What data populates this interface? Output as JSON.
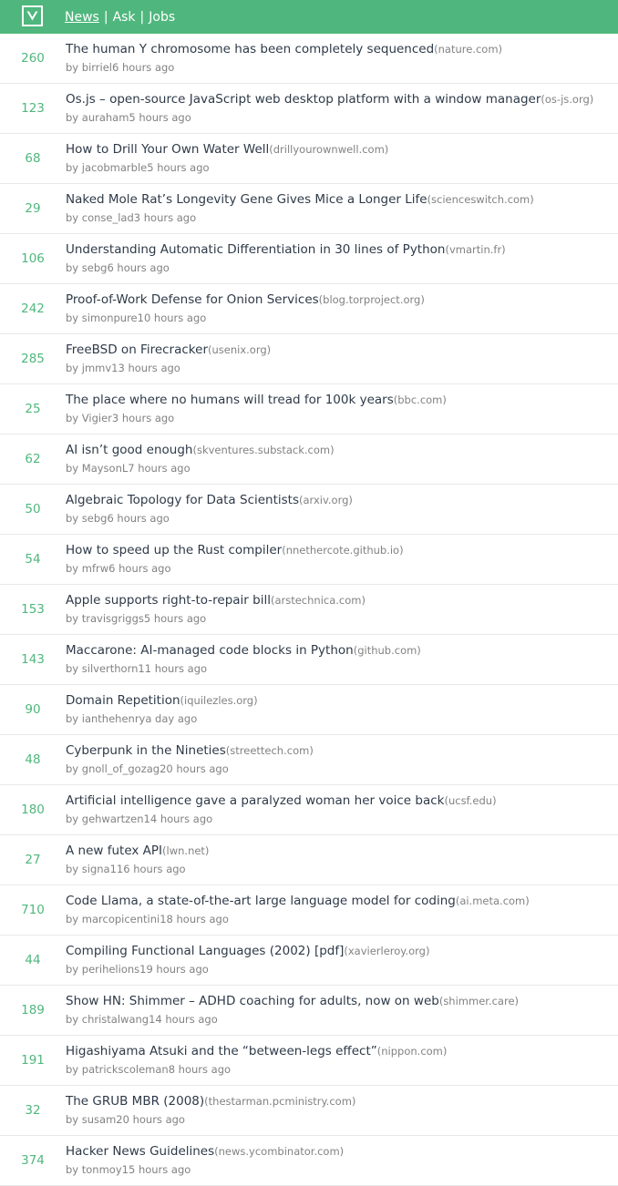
{
  "header": {
    "logo_icon": "vue-logo-icon",
    "nav": [
      {
        "label": "News",
        "active": true
      },
      {
        "label": "Ask",
        "active": false
      },
      {
        "label": "Jobs",
        "active": false
      }
    ],
    "separator": "|",
    "colors": {
      "bar": "#4fb77d",
      "text": "#ffffff"
    }
  },
  "items": [
    {
      "score": "260",
      "title": "The human Y chromosome has been completely sequenced",
      "domain": "(nature.com)",
      "by": "by ",
      "user": "birriel",
      "time": "6 hours ago"
    },
    {
      "score": "123",
      "title": "Os.js – open-source JavaScript web desktop platform with a window manager",
      "domain": "(os-js.org)",
      "by": "by ",
      "user": "auraham",
      "time": "5 hours ago"
    },
    {
      "score": "68",
      "title": "How to Drill Your Own Water Well",
      "domain": "(drillyourownwell.com)",
      "by": "by ",
      "user": "jacobmarble",
      "time": "5 hours ago"
    },
    {
      "score": "29",
      "title": "Naked Mole Rat’s Longevity Gene Gives Mice a Longer Life",
      "domain": "(scienceswitch.com)",
      "by": "by ",
      "user": "conse_lad",
      "time": "3 hours ago"
    },
    {
      "score": "106",
      "title": "Understanding Automatic Differentiation in 30 lines of Python",
      "domain": "(vmartin.fr)",
      "by": "by ",
      "user": "sebg",
      "time": "6 hours ago"
    },
    {
      "score": "242",
      "title": "Proof-of-Work Defense for Onion Services",
      "domain": "(blog.torproject.org)",
      "by": "by ",
      "user": "simonpure",
      "time": "10 hours ago"
    },
    {
      "score": "285",
      "title": "FreeBSD on Firecracker",
      "domain": "(usenix.org)",
      "by": "by ",
      "user": "jmmv",
      "time": "13 hours ago"
    },
    {
      "score": "25",
      "title": "The place where no humans will tread for 100k years",
      "domain": "(bbc.com)",
      "by": "by ",
      "user": "Vigier",
      "time": "3 hours ago"
    },
    {
      "score": "62",
      "title": "AI isn’t good enough",
      "domain": "(skventures.substack.com)",
      "by": "by ",
      "user": "MaysonL",
      "time": "7 hours ago"
    },
    {
      "score": "50",
      "title": "Algebraic Topology for Data Scientists",
      "domain": "(arxiv.org)",
      "by": "by ",
      "user": "sebg",
      "time": "6 hours ago"
    },
    {
      "score": "54",
      "title": "How to speed up the Rust compiler",
      "domain": "(nnethercote.github.io)",
      "by": "by ",
      "user": "mfrw",
      "time": "6 hours ago"
    },
    {
      "score": "153",
      "title": "Apple supports right-to-repair bill",
      "domain": "(arstechnica.com)",
      "by": "by ",
      "user": "travisgriggs",
      "time": "5 hours ago"
    },
    {
      "score": "143",
      "title": "Maccarone: AI-managed code blocks in Python",
      "domain": "(github.com)",
      "by": "by ",
      "user": "silverthorn",
      "time": "11 hours ago"
    },
    {
      "score": "90",
      "title": "Domain Repetition",
      "domain": "(iquilezles.org)",
      "by": "by ",
      "user": "ianthehenry",
      "time": "a day ago"
    },
    {
      "score": "48",
      "title": "Cyberpunk in the Nineties",
      "domain": "(streettech.com)",
      "by": "by ",
      "user": "gnoll_of_gozag",
      "time": "20 hours ago"
    },
    {
      "score": "180",
      "title": "Artificial intelligence gave a paralyzed woman her voice back",
      "domain": "(ucsf.edu)",
      "by": "by ",
      "user": "gehwartzen",
      "time": "14 hours ago"
    },
    {
      "score": "27",
      "title": "A new futex API",
      "domain": "(lwn.net)",
      "by": "by ",
      "user": "signa11",
      "time": "6 hours ago"
    },
    {
      "score": "710",
      "title": "Code Llama, a state-of-the-art large language model for coding",
      "domain": "(ai.meta.com)",
      "by": "by ",
      "user": "marcopicentini",
      "time": "18 hours ago"
    },
    {
      "score": "44",
      "title": "Compiling Functional Languages (2002) [pdf]",
      "domain": "(xavierleroy.org)",
      "by": "by ",
      "user": "perihelions",
      "time": "19 hours ago"
    },
    {
      "score": "189",
      "title": "Show HN: Shimmer – ADHD coaching for adults, now on web",
      "domain": "(shimmer.care)",
      "by": "by ",
      "user": "christalwang",
      "time": "14 hours ago"
    },
    {
      "score": "191",
      "title": "Higashiyama Atsuki and the “between-legs effect”",
      "domain": "(nippon.com)",
      "by": "by ",
      "user": "patrickscoleman",
      "time": "8 hours ago"
    },
    {
      "score": "32",
      "title": "The GRUB MBR (2008)",
      "domain": "(thestarman.pcministry.com)",
      "by": "by ",
      "user": "susam",
      "time": "20 hours ago"
    },
    {
      "score": "374",
      "title": "Hacker News Guidelines",
      "domain": "(news.ycombinator.com)",
      "by": "by ",
      "user": "tonmoy",
      "time": "15 hours ago"
    }
  ]
}
